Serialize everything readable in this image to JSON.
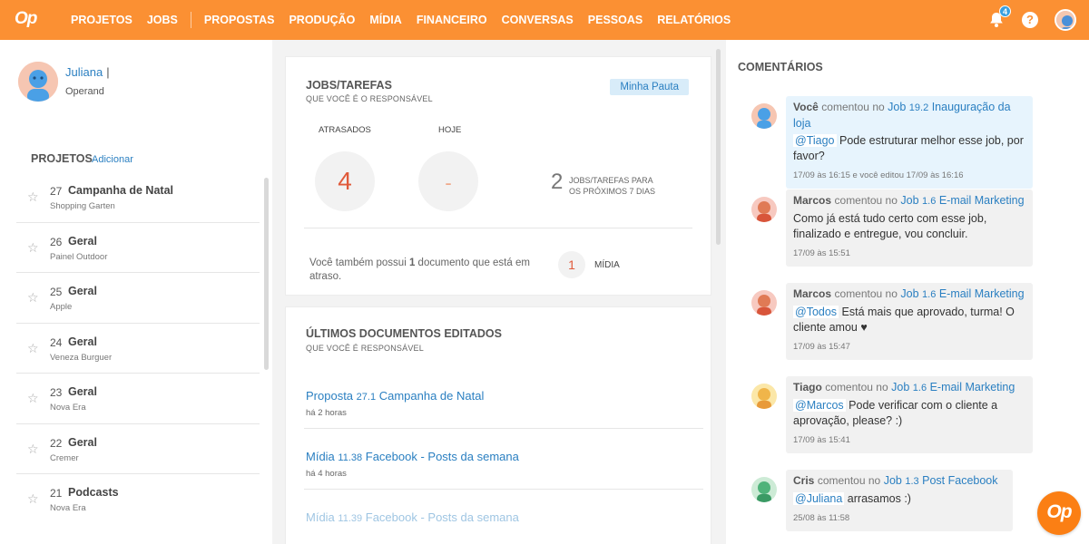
{
  "app": {
    "logo": "Op"
  },
  "nav": [
    {
      "label": "PROJETOS"
    },
    {
      "label": "JOBS"
    },
    {
      "label": "PROPOSTAS"
    },
    {
      "label": "PRODUÇÃO"
    },
    {
      "label": "MÍDIA"
    },
    {
      "label": "FINANCEIRO"
    },
    {
      "label": "CONVERSAS"
    },
    {
      "label": "PESSOAS"
    },
    {
      "label": "RELATÓRIOS"
    }
  ],
  "header": {
    "notifications": "4",
    "help": "?"
  },
  "user": {
    "name": "Juliana",
    "separator": "|",
    "org": "Operand"
  },
  "projects": {
    "title": "PROJETOS",
    "add_label": "Adicionar",
    "items": [
      {
        "num": "27",
        "title": "Campanha de Natal",
        "client": "Shopping Garten"
      },
      {
        "num": "26",
        "title": "Geral",
        "client": "Painel Outdoor"
      },
      {
        "num": "25",
        "title": "Geral",
        "client": "Apple"
      },
      {
        "num": "24",
        "title": "Geral",
        "client": "Veneza Burguer"
      },
      {
        "num": "23",
        "title": "Geral",
        "client": "Nova Era"
      },
      {
        "num": "22",
        "title": "Geral",
        "client": "Cremer"
      },
      {
        "num": "21",
        "title": "Podcasts",
        "client": "Nova Era"
      }
    ]
  },
  "jobs": {
    "title": "JOBS/TAREFAS",
    "subtitle": "QUE VOCÊ É O RESPONSÁVEL",
    "pauta_button": "Minha Pauta",
    "late_label": "ATRASADOS",
    "late_value": "4",
    "today_label": "HOJE",
    "today_value": "-",
    "next_value": "2",
    "next_line1": "JOBS/TAREFAS PARA",
    "next_line2": "OS PRÓXIMOS 7 DIAS",
    "late_docs_pre": "Você também possui ",
    "late_docs_count": "1",
    "late_docs_post": " documento que está em atraso.",
    "midia_count": "1",
    "midia_label": "MÍDIA"
  },
  "docs": {
    "title": "ÚLTIMOS DOCUMENTOS EDITADOS",
    "subtitle": "QUE VOCÊ É RESPONSÁVEL",
    "items": [
      {
        "type": "Proposta",
        "num": "27.1",
        "name": "Campanha de Natal",
        "time": "há 2 horas"
      },
      {
        "type": "Mídia",
        "num": "11.38",
        "name": "Facebook - Posts da semana",
        "time": "há 4 horas"
      },
      {
        "type": "Mídia",
        "num": "11.39",
        "name": "Facebook - Posts da semana",
        "time": ""
      }
    ]
  },
  "comments": {
    "title": "COMENTÁRIOS",
    "items": [
      {
        "author": "Você",
        "verb": "comentou no",
        "job_word": "Job",
        "job_num": "19.2",
        "job_name": "Inauguração da loja",
        "mention": "@Tiago",
        "text": "Pode estruturar melhor esse job, por favor?",
        "time": "17/09 às 16:15 e você editou 17/09 às 16:16"
      },
      {
        "author": "Marcos",
        "verb": "comentou no",
        "job_word": "Job",
        "job_num": "1.6",
        "job_name": "E-mail Marketing",
        "mention": "",
        "text": "Como já está tudo certo com esse job, finalizado e entregue, vou concluir.",
        "time": "17/09 às 15:51"
      },
      {
        "author": "Marcos",
        "verb": "comentou no",
        "job_word": "Job",
        "job_num": "1.6",
        "job_name": "E-mail Marketing",
        "mention": "@Todos",
        "text": "Está mais que aprovado, turma! O cliente amou ♥",
        "time": "17/09 às 15:47"
      },
      {
        "author": "Tiago",
        "verb": "comentou no",
        "job_word": "Job",
        "job_num": "1.6",
        "job_name": "E-mail Marketing",
        "mention": "@Marcos",
        "text": "Pode verificar com o cliente a aprovação, please? :)",
        "time": "17/09 às 15:41"
      },
      {
        "author": "Cris",
        "verb": "comentou no",
        "job_word": "Job",
        "job_num": "1.3",
        "job_name": "Post Facebook",
        "mention": "@Juliana",
        "text": "arrasamos :)",
        "time": "25/08 às 11:58"
      }
    ]
  },
  "fab": {
    "label": "Op"
  },
  "colors": {
    "brand": "#fb9033",
    "link": "#2a7fc1",
    "alert": "#e05a3a"
  }
}
